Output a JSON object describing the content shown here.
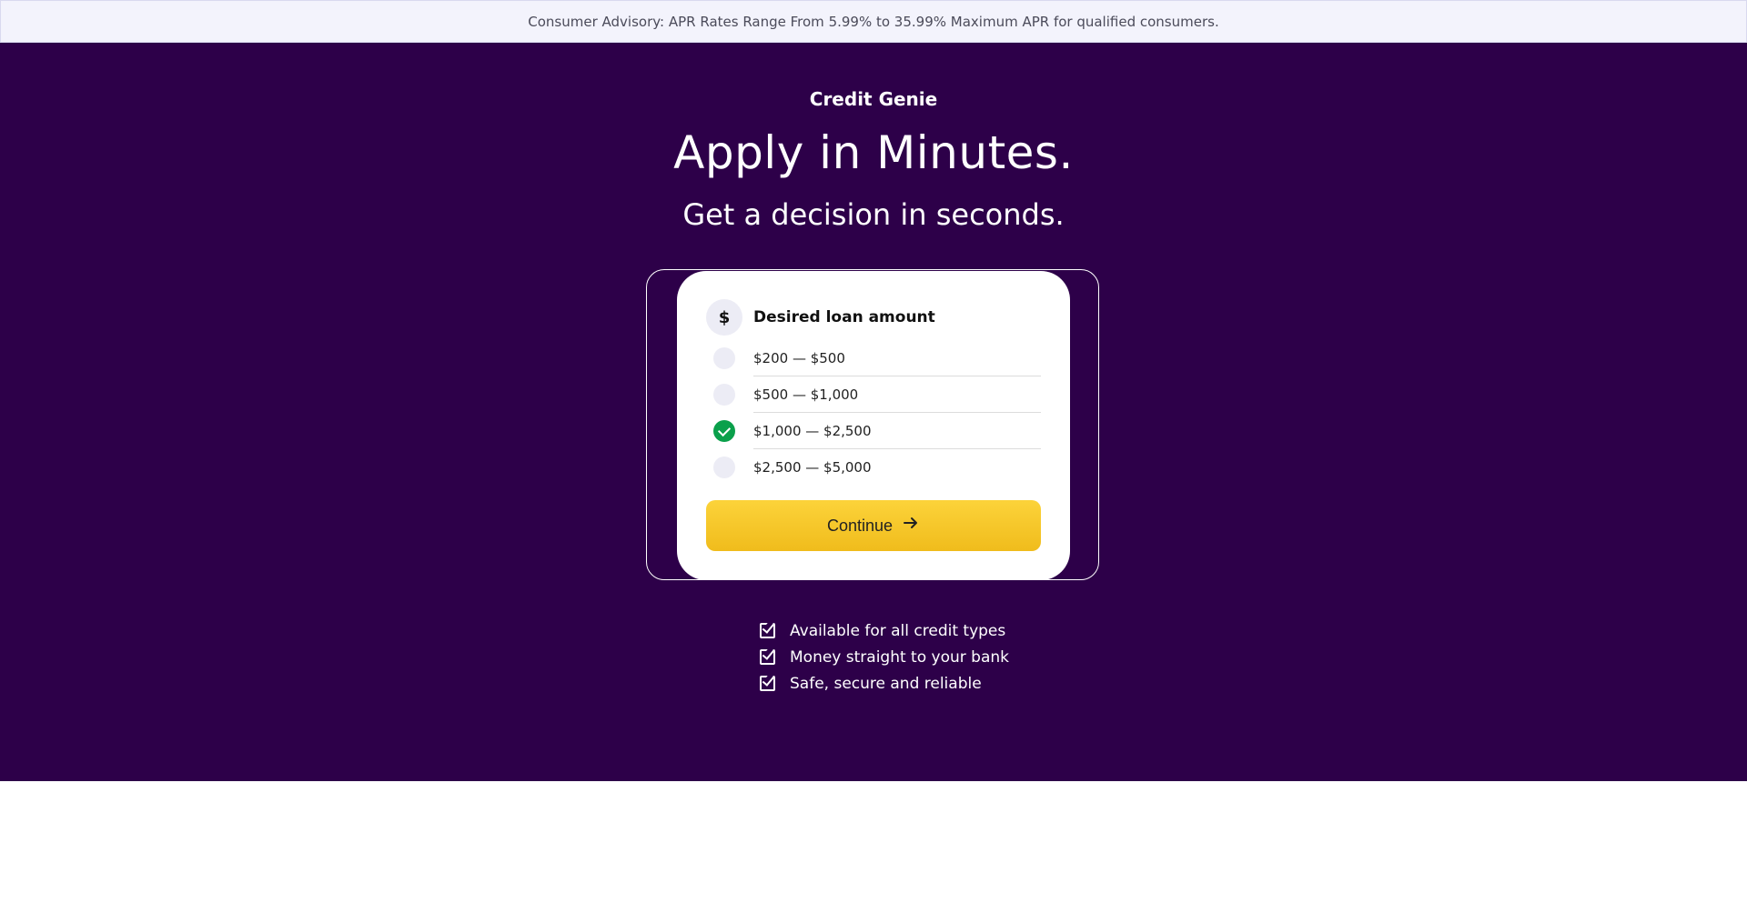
{
  "advisory": {
    "text": "Consumer Advisory: APR Rates Range From 5.99% to 35.99% Maximum APR for qualified consumers."
  },
  "hero": {
    "brand": "Credit Genie",
    "headline": "Apply in Minutes.",
    "subheadline": "Get a decision in seconds."
  },
  "form": {
    "icon": "dollar-icon",
    "icon_glyph": "$",
    "title": "Desired loan amount",
    "options": [
      {
        "label": "$200 — $500",
        "selected": false
      },
      {
        "label": "$500 — $1,000",
        "selected": false
      },
      {
        "label": "$1,000 — $2,500",
        "selected": true
      },
      {
        "label": "$2,500 — $5,000",
        "selected": false
      }
    ],
    "continue_label": "Continue",
    "continue_icon": "arrow-right-icon"
  },
  "benefits": [
    {
      "label": "Available for all credit types",
      "icon": "checkbox-checked-icon"
    },
    {
      "label": "Money straight to your bank",
      "icon": "checkbox-checked-icon"
    },
    {
      "label": "Safe, secure and reliable",
      "icon": "checkbox-checked-icon"
    }
  ],
  "colors": {
    "hero_bg": "#2d0049",
    "advisory_bg": "#f3f3fc",
    "accent_button": "#f8c92b",
    "selected_radio": "#0aa04b"
  }
}
